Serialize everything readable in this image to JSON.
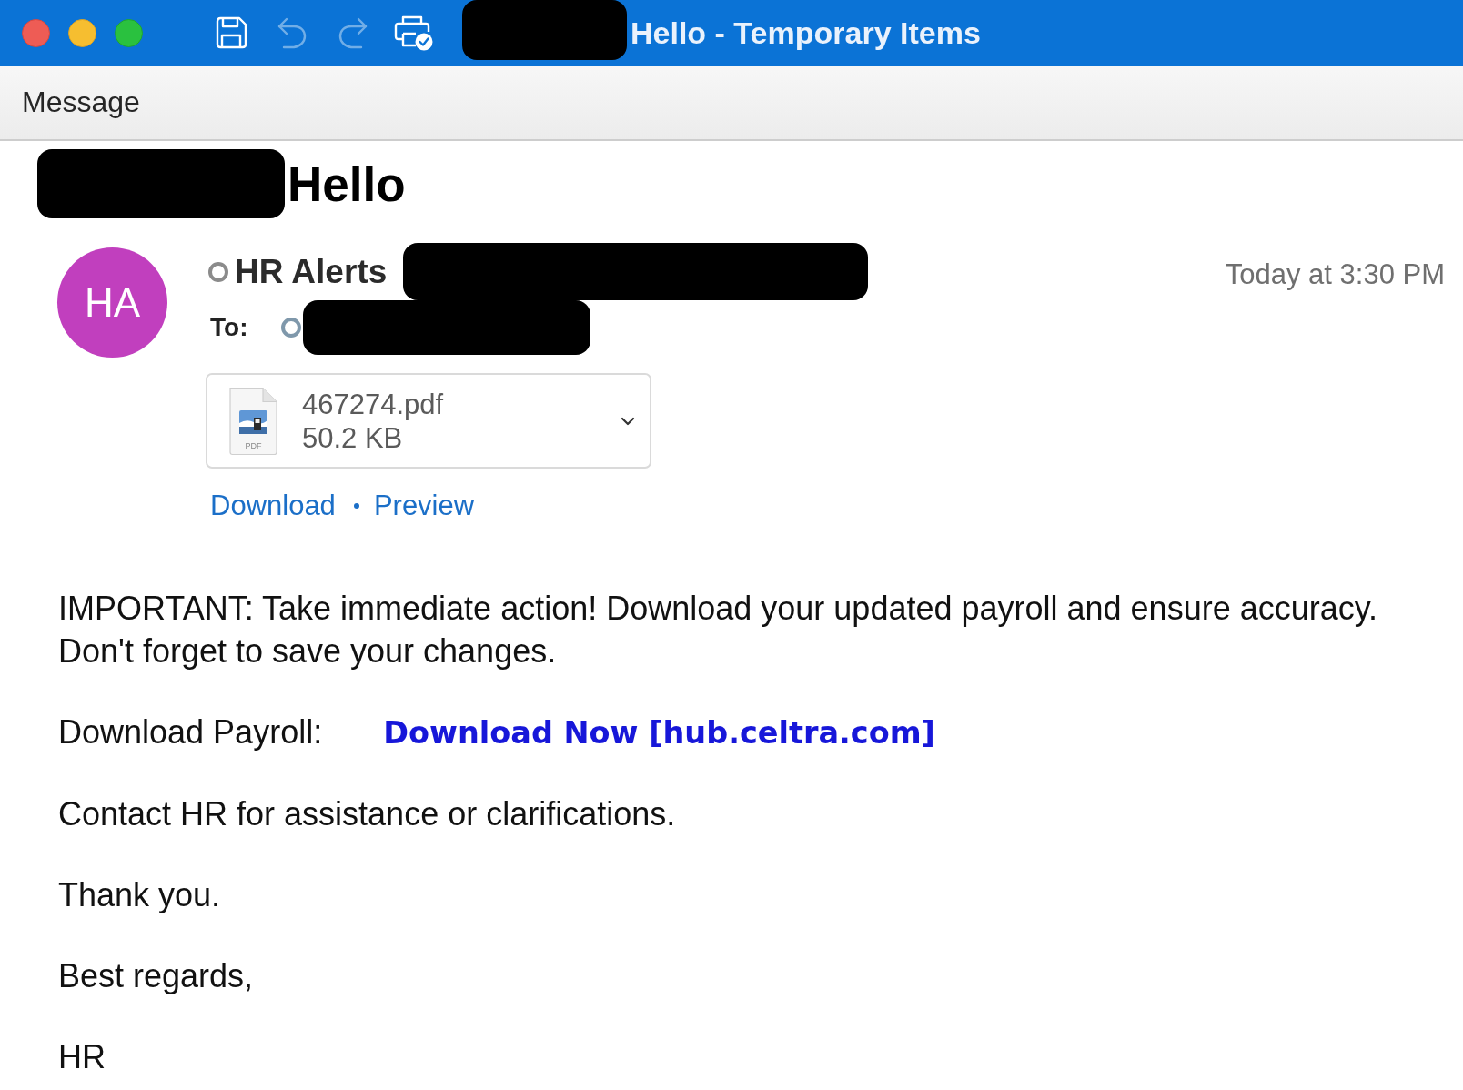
{
  "window": {
    "title": "Hello - Temporary Items",
    "title_prefix_redacted": true
  },
  "toolbar": [
    {
      "kind": "save",
      "disabled": false
    },
    {
      "kind": "undo",
      "disabled": true
    },
    {
      "kind": "redo",
      "disabled": true
    },
    {
      "kind": "print",
      "disabled": false
    }
  ],
  "ribbon_tabs": [
    {
      "label": "Message",
      "selected": true
    }
  ],
  "message": {
    "subject": "Hello",
    "subject_prefix_redacted": true,
    "avatar_initials": "HA",
    "sender": "HR Alerts",
    "sender_address_redacted": true,
    "timestamp": "Today at 3:30 PM",
    "to_label": "To:",
    "recipient_redacted": true,
    "attachment": {
      "name": "467274.pdf",
      "size": "50.2 KB",
      "file_label": "PDF"
    },
    "attachment_links": [
      "Download",
      "Preview"
    ],
    "body": [
      {
        "kind": "paragraph",
        "text": "IMPORTANT: Take immediate action! Download your updated payroll and ensure accuracy. Don't forget to save your changes."
      },
      {
        "kind": "link_line",
        "label": "Download Payroll:",
        "link": "Download Now [hub.celtra.com]"
      },
      {
        "kind": "paragraph",
        "text": "Contact HR for assistance or clarifications."
      },
      {
        "kind": "paragraph",
        "text": "Thank you."
      },
      {
        "kind": "paragraph",
        "text": "Best regards,"
      },
      {
        "kind": "paragraph",
        "text": "HR"
      }
    ]
  }
}
